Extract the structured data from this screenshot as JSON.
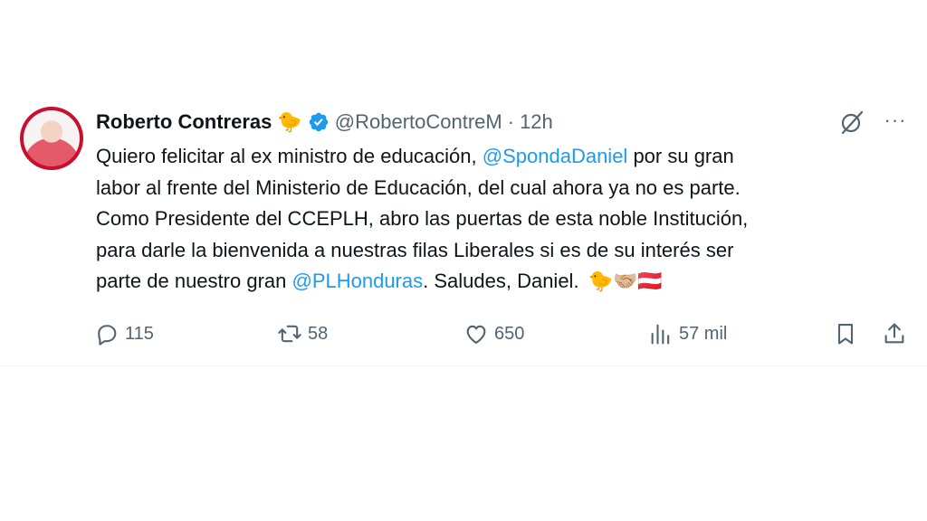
{
  "tweet": {
    "name": "Roberto Contreras",
    "name_emoji": "🐤",
    "handle": "@RobertoContreM",
    "separator": "·",
    "time": "12h",
    "more": "···",
    "lines": [
      {
        "before": "Quiero felicitar al ex ministro de educación, ",
        "mention": "@SpondaDaniel",
        "after": " por su gran"
      },
      {
        "text": "labor al frente del Ministerio de Educación, del cual ahora ya no es parte."
      },
      {
        "text": "Como Presidente del CCEPLH, abro las puertas de esta noble Institución,"
      },
      {
        "text": "para darle la bienvenida a nuestras filas Liberales si es de su interés ser"
      },
      {
        "before": "parte de nuestro gran ",
        "mention": "@PLHonduras",
        "after": ". Saludes, Daniel.",
        "emojis": "🐤🤝🏼🇦🇹"
      }
    ]
  },
  "actions": {
    "replies": "115",
    "reposts": "58",
    "likes": "650",
    "views": "57 mil"
  },
  "colors": {
    "accent": "#1d9bf0",
    "muted": "#536471",
    "text": "#0f1419"
  }
}
